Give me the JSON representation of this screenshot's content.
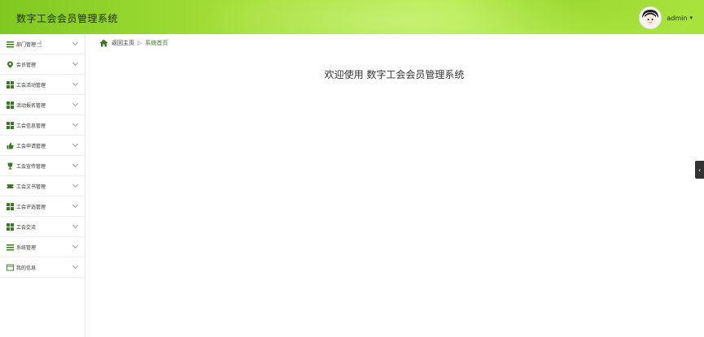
{
  "header": {
    "title": "数字工会会员管理系统",
    "username": "admin",
    "caret": "▾",
    "brand_color": "#a6e03a"
  },
  "sidebar": {
    "items": [
      {
        "label": "部门管理",
        "icon": "list-icon"
      },
      {
        "label": "会员管理",
        "icon": "pin-icon"
      },
      {
        "label": "工会活动管理",
        "icon": "grid-icon"
      },
      {
        "label": "活动报名管理",
        "icon": "grid-icon"
      },
      {
        "label": "工会信息管理",
        "icon": "grid-icon"
      },
      {
        "label": "工会申请管理",
        "icon": "thumb-icon"
      },
      {
        "label": "工会宣传管理",
        "icon": "trophy-icon"
      },
      {
        "label": "工会文书管理",
        "icon": "ticket-icon"
      },
      {
        "label": "工会评选管理",
        "icon": "grid-icon"
      },
      {
        "label": "工会交流",
        "icon": "grid-icon"
      },
      {
        "label": "系统管理",
        "icon": "list-icon"
      },
      {
        "label": "我的信息",
        "icon": "card-icon"
      }
    ]
  },
  "breadcrumb": {
    "home": "返回主页",
    "separator": "▷",
    "current": "系统首页"
  },
  "main": {
    "welcome": "欢迎使用 数字工会会员管理系统"
  },
  "side_handle": {
    "glyph": "‹"
  }
}
